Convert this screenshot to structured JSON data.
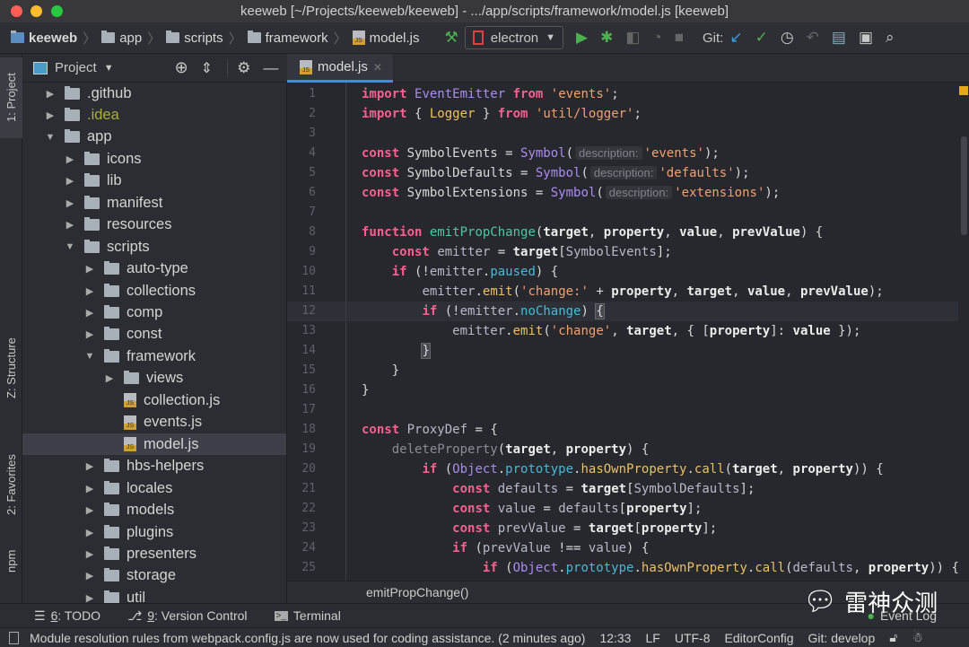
{
  "window": {
    "title": "keeweb [~/Projects/keeweb/keeweb] - .../app/scripts/framework/model.js [keeweb]"
  },
  "toolbar": {
    "breadcrumbs": [
      "keeweb",
      "app",
      "scripts",
      "framework",
      "model.js"
    ],
    "run_config": "electron",
    "git_label": "Git:",
    "icons": [
      "build-hammer-icon",
      "run-icon",
      "debug-icon",
      "coverage-icon",
      "profile-icon",
      "stop-icon",
      "git-update-icon",
      "git-commit-icon",
      "history-icon",
      "rollback-icon",
      "project-structure-icon",
      "terminal-icon",
      "search-icon"
    ]
  },
  "left_strip": {
    "tabs": [
      "1: Project",
      "Z: Structure",
      "2: Favorites",
      "npm"
    ]
  },
  "project_panel": {
    "title": "Project",
    "tree": [
      {
        "label": ".github",
        "depth": 0,
        "kind": "folder",
        "expanded": false
      },
      {
        "label": ".idea",
        "depth": 0,
        "kind": "folder",
        "expanded": false,
        "color": "#a9b03a"
      },
      {
        "label": "app",
        "depth": 0,
        "kind": "folder",
        "expanded": true
      },
      {
        "label": "icons",
        "depth": 1,
        "kind": "folder",
        "expanded": false
      },
      {
        "label": "lib",
        "depth": 1,
        "kind": "folder",
        "expanded": false
      },
      {
        "label": "manifest",
        "depth": 1,
        "kind": "folder",
        "expanded": false
      },
      {
        "label": "resources",
        "depth": 1,
        "kind": "folder",
        "expanded": false
      },
      {
        "label": "scripts",
        "depth": 1,
        "kind": "folder",
        "expanded": true
      },
      {
        "label": "auto-type",
        "depth": 2,
        "kind": "folder",
        "expanded": false
      },
      {
        "label": "collections",
        "depth": 2,
        "kind": "folder",
        "expanded": false
      },
      {
        "label": "comp",
        "depth": 2,
        "kind": "folder",
        "expanded": false
      },
      {
        "label": "const",
        "depth": 2,
        "kind": "folder",
        "expanded": false
      },
      {
        "label": "framework",
        "depth": 2,
        "kind": "folder",
        "expanded": true
      },
      {
        "label": "views",
        "depth": 3,
        "kind": "folder",
        "expanded": false
      },
      {
        "label": "collection.js",
        "depth": 3,
        "kind": "js"
      },
      {
        "label": "events.js",
        "depth": 3,
        "kind": "js"
      },
      {
        "label": "model.js",
        "depth": 3,
        "kind": "js",
        "selected": true
      },
      {
        "label": "hbs-helpers",
        "depth": 2,
        "kind": "folder",
        "expanded": false
      },
      {
        "label": "locales",
        "depth": 2,
        "kind": "folder",
        "expanded": false
      },
      {
        "label": "models",
        "depth": 2,
        "kind": "folder",
        "expanded": false
      },
      {
        "label": "plugins",
        "depth": 2,
        "kind": "folder",
        "expanded": false
      },
      {
        "label": "presenters",
        "depth": 2,
        "kind": "folder",
        "expanded": false
      },
      {
        "label": "storage",
        "depth": 2,
        "kind": "folder",
        "expanded": false
      },
      {
        "label": "util",
        "depth": 2,
        "kind": "folder",
        "expanded": false
      }
    ]
  },
  "editor": {
    "tab": "model.js",
    "current_line": 12,
    "lines": [
      [
        [
          "k",
          "import"
        ],
        [
          "t",
          " "
        ],
        [
          "c",
          "EventEmitter"
        ],
        [
          "t",
          " "
        ],
        [
          "k",
          "from"
        ],
        [
          "t",
          " "
        ],
        [
          "s",
          "'events'"
        ],
        [
          "t",
          ";"
        ]
      ],
      [
        [
          "k",
          "import"
        ],
        [
          "t",
          " { "
        ],
        [
          "n",
          "Logger"
        ],
        [
          "t",
          " } "
        ],
        [
          "k",
          "from"
        ],
        [
          "t",
          " "
        ],
        [
          "s",
          "'util/logger'"
        ],
        [
          "t",
          ";"
        ]
      ],
      [],
      [
        [
          "k",
          "const"
        ],
        [
          "t",
          " SymbolEvents = "
        ],
        [
          "c",
          "Symbol"
        ],
        [
          "t",
          "("
        ],
        [
          "h",
          "description:"
        ],
        [
          "s",
          "'events'"
        ],
        [
          "t",
          ");"
        ]
      ],
      [
        [
          "k",
          "const"
        ],
        [
          "t",
          " SymbolDefaults = "
        ],
        [
          "c",
          "Symbol"
        ],
        [
          "t",
          "("
        ],
        [
          "h",
          "description:"
        ],
        [
          "s",
          "'defaults'"
        ],
        [
          "t",
          ");"
        ]
      ],
      [
        [
          "k",
          "const"
        ],
        [
          "t",
          " SymbolExtensions = "
        ],
        [
          "c",
          "Symbol"
        ],
        [
          "t",
          "("
        ],
        [
          "h",
          "description:"
        ],
        [
          "s",
          "'extensions'"
        ],
        [
          "t",
          ");"
        ]
      ],
      [],
      [
        [
          "k",
          "function"
        ],
        [
          "t",
          " "
        ],
        [
          "f",
          "emitPropChange"
        ],
        [
          "t",
          "("
        ],
        [
          "a",
          "target"
        ],
        [
          "t",
          ", "
        ],
        [
          "a",
          "property"
        ],
        [
          "t",
          ", "
        ],
        [
          "a",
          "value"
        ],
        [
          "t",
          ", "
        ],
        [
          "a",
          "prevValue"
        ],
        [
          "t",
          ") {"
        ]
      ],
      [
        [
          "t",
          "    "
        ],
        [
          "k",
          "const"
        ],
        [
          "t",
          " "
        ],
        [
          "v",
          "emitter"
        ],
        [
          "t",
          " = "
        ],
        [
          "a",
          "target"
        ],
        [
          "t",
          "["
        ],
        [
          "v",
          "SymbolEvents"
        ],
        [
          "t",
          "];"
        ]
      ],
      [
        [
          "t",
          "    "
        ],
        [
          "k",
          "if"
        ],
        [
          "t",
          " (!"
        ],
        [
          "v",
          "emitter"
        ],
        [
          "t",
          "."
        ],
        [
          "p",
          "paused"
        ],
        [
          "t",
          ") {"
        ]
      ],
      [
        [
          "t",
          "        "
        ],
        [
          "v",
          "emitter"
        ],
        [
          "t",
          "."
        ],
        [
          "m",
          "emit"
        ],
        [
          "t",
          "("
        ],
        [
          "s",
          "'change:'"
        ],
        [
          "t",
          " + "
        ],
        [
          "a",
          "property"
        ],
        [
          "t",
          ", "
        ],
        [
          "a",
          "target"
        ],
        [
          "t",
          ", "
        ],
        [
          "a",
          "value"
        ],
        [
          "t",
          ", "
        ],
        [
          "a",
          "prevValue"
        ],
        [
          "t",
          ");"
        ]
      ],
      [
        [
          "t",
          "        "
        ],
        [
          "k",
          "if"
        ],
        [
          "t",
          " (!"
        ],
        [
          "v",
          "emitter"
        ],
        [
          "t",
          "."
        ],
        [
          "p",
          "noChange"
        ],
        [
          "t",
          ") "
        ],
        [
          "b",
          "{"
        ]
      ],
      [
        [
          "t",
          "            "
        ],
        [
          "v",
          "emitter"
        ],
        [
          "t",
          "."
        ],
        [
          "m",
          "emit"
        ],
        [
          "t",
          "("
        ],
        [
          "s",
          "'change'"
        ],
        [
          "t",
          ", "
        ],
        [
          "a",
          "target"
        ],
        [
          "t",
          ", { ["
        ],
        [
          "a",
          "property"
        ],
        [
          "t",
          "]: "
        ],
        [
          "a",
          "value"
        ],
        [
          "t",
          " });"
        ]
      ],
      [
        [
          "t",
          "        "
        ],
        [
          "b",
          "}"
        ]
      ],
      [
        [
          "t",
          "    }"
        ]
      ],
      [
        [
          "t",
          "}"
        ]
      ],
      [],
      [
        [
          "k",
          "const"
        ],
        [
          "t",
          " "
        ],
        [
          "v",
          "ProxyDef"
        ],
        [
          "t",
          " = {"
        ]
      ],
      [
        [
          "t",
          "    "
        ],
        [
          "u",
          "deleteProperty"
        ],
        [
          "t",
          "("
        ],
        [
          "a",
          "target"
        ],
        [
          "t",
          ", "
        ],
        [
          "a",
          "property"
        ],
        [
          "t",
          ") {"
        ]
      ],
      [
        [
          "t",
          "        "
        ],
        [
          "k",
          "if"
        ],
        [
          "t",
          " ("
        ],
        [
          "c",
          "Object"
        ],
        [
          "t",
          "."
        ],
        [
          "p",
          "prototype"
        ],
        [
          "t",
          "."
        ],
        [
          "m",
          "hasOwnProperty"
        ],
        [
          "t",
          "."
        ],
        [
          "m",
          "call"
        ],
        [
          "t",
          "("
        ],
        [
          "a",
          "target"
        ],
        [
          "t",
          ", "
        ],
        [
          "a",
          "property"
        ],
        [
          "t",
          ")) {"
        ]
      ],
      [
        [
          "t",
          "            "
        ],
        [
          "k",
          "const"
        ],
        [
          "t",
          " "
        ],
        [
          "v",
          "defaults"
        ],
        [
          "t",
          " = "
        ],
        [
          "a",
          "target"
        ],
        [
          "t",
          "["
        ],
        [
          "v",
          "SymbolDefaults"
        ],
        [
          "t",
          "];"
        ]
      ],
      [
        [
          "t",
          "            "
        ],
        [
          "k",
          "const"
        ],
        [
          "t",
          " "
        ],
        [
          "v",
          "value"
        ],
        [
          "t",
          " = "
        ],
        [
          "v",
          "defaults"
        ],
        [
          "t",
          "["
        ],
        [
          "a",
          "property"
        ],
        [
          "t",
          "];"
        ]
      ],
      [
        [
          "t",
          "            "
        ],
        [
          "k",
          "const"
        ],
        [
          "t",
          " "
        ],
        [
          "v",
          "prevValue"
        ],
        [
          "t",
          " = "
        ],
        [
          "a",
          "target"
        ],
        [
          "t",
          "["
        ],
        [
          "a",
          "property"
        ],
        [
          "t",
          "];"
        ]
      ],
      [
        [
          "t",
          "            "
        ],
        [
          "k",
          "if"
        ],
        [
          "t",
          " ("
        ],
        [
          "v",
          "prevValue"
        ],
        [
          "t",
          " !== "
        ],
        [
          "v",
          "value"
        ],
        [
          "t",
          ") {"
        ]
      ],
      [
        [
          "t",
          "                "
        ],
        [
          "k",
          "if"
        ],
        [
          "t",
          " ("
        ],
        [
          "c",
          "Object"
        ],
        [
          "t",
          "."
        ],
        [
          "p",
          "prototype"
        ],
        [
          "t",
          "."
        ],
        [
          "m",
          "hasOwnProperty"
        ],
        [
          "t",
          "."
        ],
        [
          "m",
          "call"
        ],
        [
          "t",
          "("
        ],
        [
          "v",
          "defaults"
        ],
        [
          "t",
          ", "
        ],
        [
          "a",
          "property"
        ],
        [
          "t",
          ")) {"
        ]
      ]
    ],
    "breadcrumb": "emitPropChange()"
  },
  "tool_windows": [
    {
      "num": "6",
      "label": ": TODO",
      "icon": "todo-list-icon"
    },
    {
      "num": "9",
      "label": ": Version Control",
      "icon": "version-control-icon"
    },
    {
      "num": "",
      "label": "Terminal",
      "icon": "terminal-icon"
    }
  ],
  "event_log": "Event Log",
  "watermark": "雷神众测",
  "status": {
    "message": "Module resolution rules from webpack.config.js are now used for coding assistance. (2 minutes ago)",
    "position": "12:33",
    "line_sep": "LF",
    "encoding": "UTF-8",
    "editorconfig": "EditorConfig",
    "git_branch": "Git: develop"
  },
  "colors": {
    "keyword": "#fc5f90",
    "string": "#f3a070",
    "class": "#aa8cf0",
    "function": "#4cc8a5",
    "accent": "#3d8fd6"
  }
}
